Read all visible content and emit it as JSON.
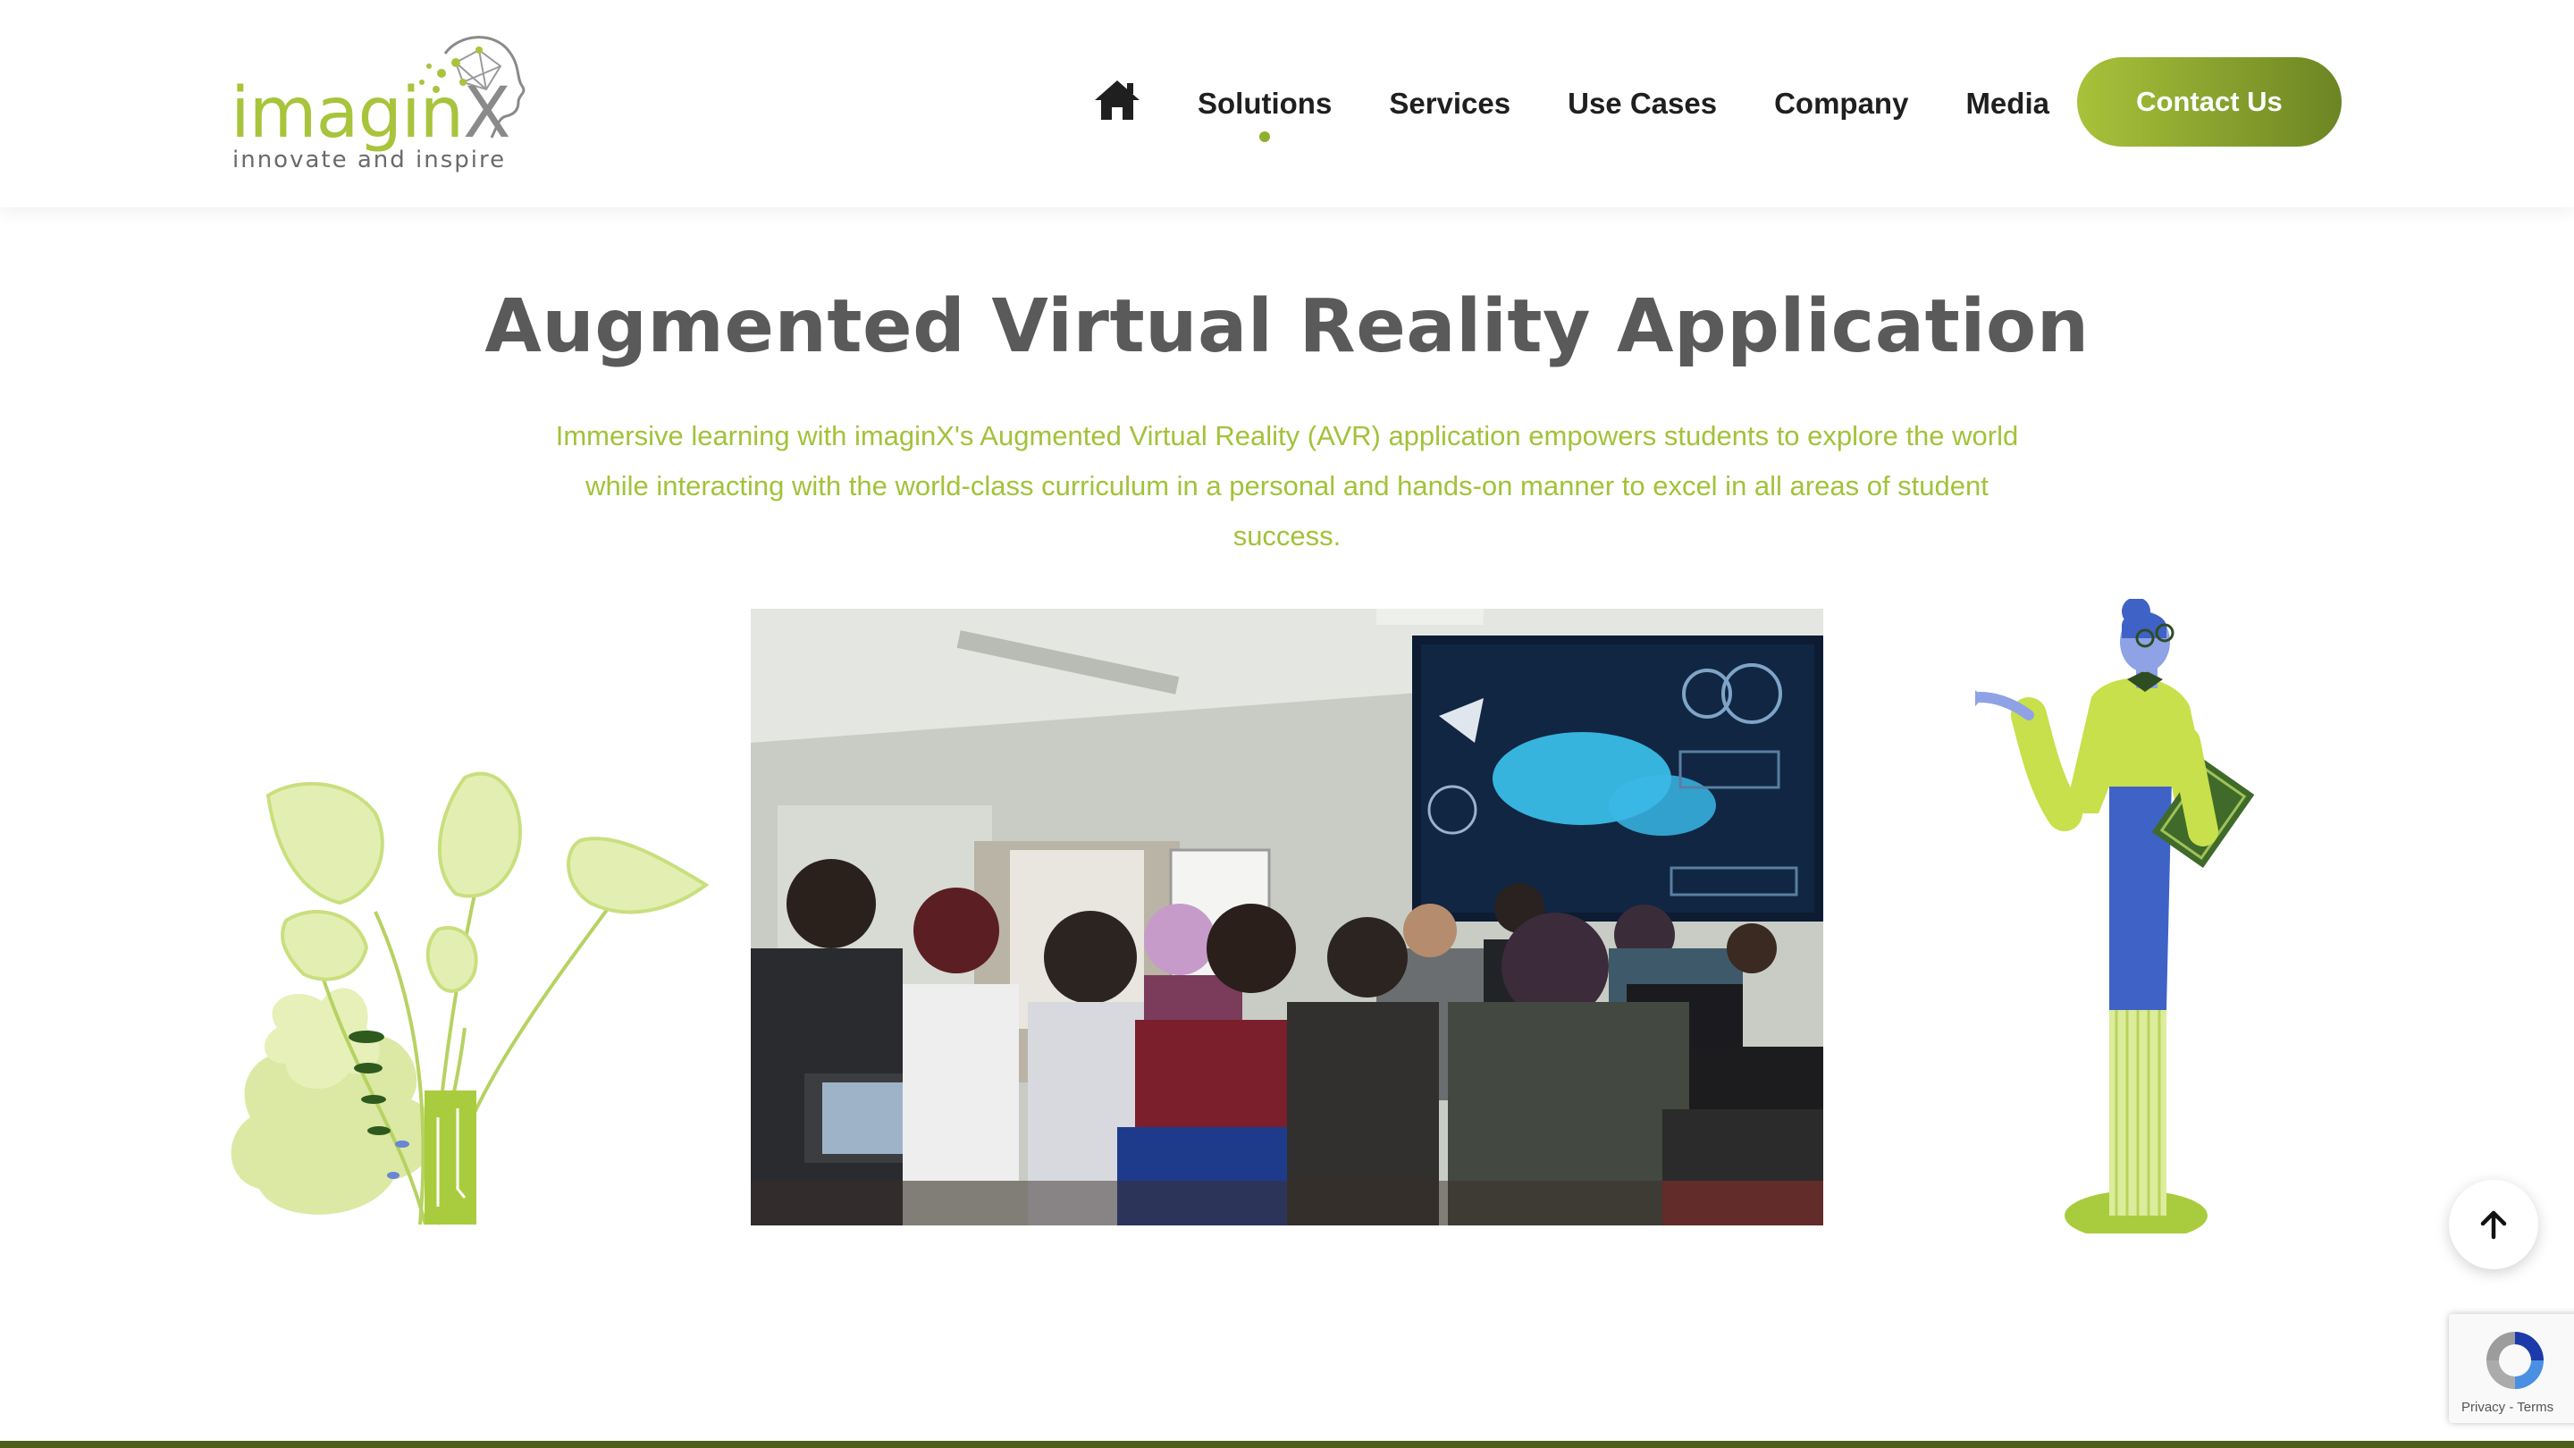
{
  "brand": {
    "logo_word": "imagin",
    "logo_x": "X",
    "tagline": "innovate and inspire",
    "accent_color": "#a8c43c",
    "dark_accent": "#6c8523"
  },
  "nav": {
    "home_icon": "home-icon",
    "items": [
      {
        "label": "Solutions",
        "active": true
      },
      {
        "label": "Services"
      },
      {
        "label": "Use Cases"
      },
      {
        "label": "Company"
      },
      {
        "label": "Media"
      }
    ],
    "contact_label": "Contact Us"
  },
  "main": {
    "title": "Augmented Virtual Reality Application",
    "intro": "Immersive learning with imaginX's Augmented Virtual Reality (AVR) application empowers students to explore the world while interacting with the world-class curriculum in a personal and hands-on manner to excel in all areas of student success."
  },
  "widgets": {
    "scroll_top_icon": "arrow-up-icon",
    "recaptcha_links": "Privacy - Terms"
  }
}
